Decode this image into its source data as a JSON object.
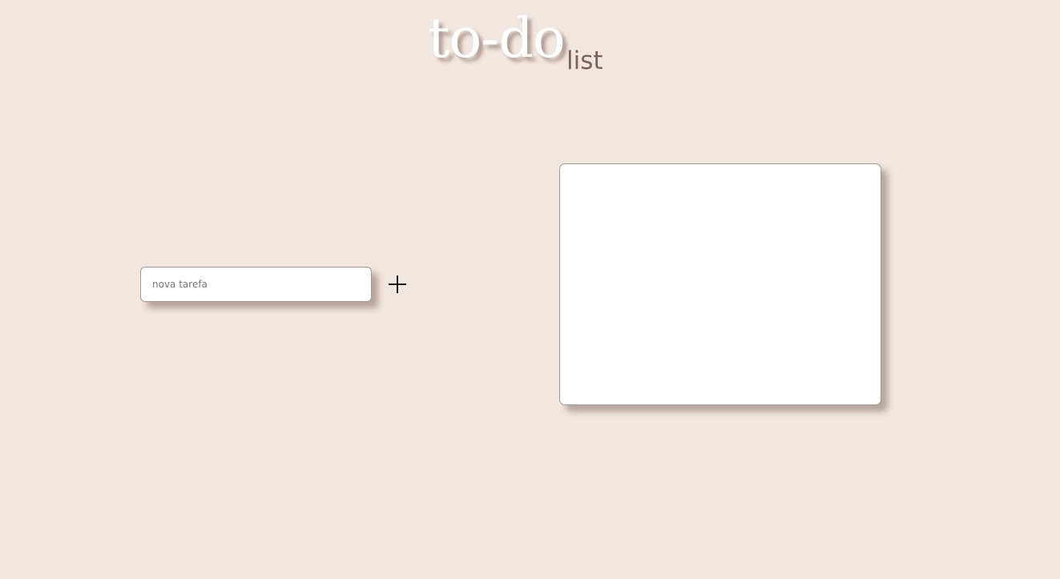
{
  "header": {
    "title_main": "to-do",
    "title_sub": "list"
  },
  "task_form": {
    "input_placeholder": "nova tarefa",
    "input_value": "",
    "add_icon": "plus-icon"
  },
  "task_list": {
    "items": []
  },
  "colors": {
    "background": "#f1e6e0",
    "title_main": "#ffffff",
    "title_sub": "#7a635a",
    "border": "#a99891",
    "panel": "#ffffff"
  }
}
